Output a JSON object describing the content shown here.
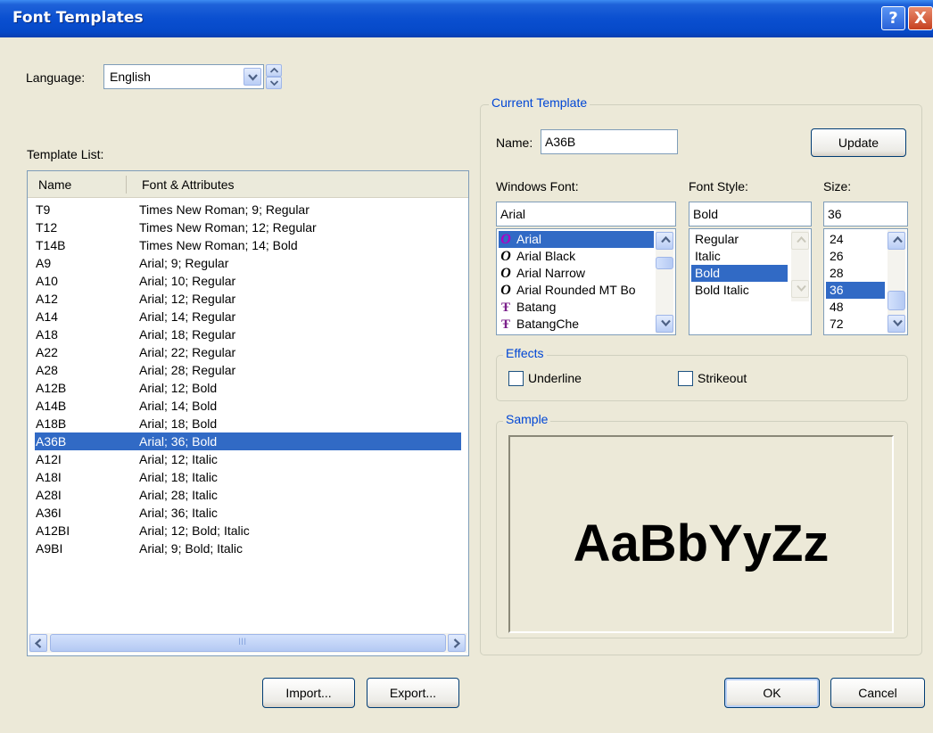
{
  "window": {
    "title": "Font Templates",
    "help_glyph": "?",
    "close_glyph": "X"
  },
  "language": {
    "label": "Language:",
    "value": "English"
  },
  "template_list": {
    "label": "Template List:",
    "columns": [
      "Name",
      "Font & Attributes"
    ],
    "rows": [
      {
        "name": "T9",
        "attrs": "Times New Roman; 9; Regular"
      },
      {
        "name": "T12",
        "attrs": "Times New Roman; 12; Regular"
      },
      {
        "name": "T14B",
        "attrs": "Times New Roman; 14; Bold"
      },
      {
        "name": "A9",
        "attrs": "Arial; 9; Regular"
      },
      {
        "name": "A10",
        "attrs": "Arial; 10; Regular"
      },
      {
        "name": "A12",
        "attrs": "Arial; 12; Regular"
      },
      {
        "name": "A14",
        "attrs": "Arial; 14; Regular"
      },
      {
        "name": "A18",
        "attrs": "Arial; 18; Regular"
      },
      {
        "name": "A22",
        "attrs": "Arial; 22; Regular"
      },
      {
        "name": "A28",
        "attrs": "Arial; 28; Regular"
      },
      {
        "name": "A12B",
        "attrs": "Arial; 12; Bold"
      },
      {
        "name": "A14B",
        "attrs": "Arial; 14; Bold"
      },
      {
        "name": "A18B",
        "attrs": "Arial; 18; Bold"
      },
      {
        "name": "A36B",
        "attrs": "Arial; 36; Bold"
      },
      {
        "name": "A12I",
        "attrs": "Arial; 12; Italic"
      },
      {
        "name": "A18I",
        "attrs": "Arial; 18; Italic"
      },
      {
        "name": "A28I",
        "attrs": "Arial; 28; Italic"
      },
      {
        "name": "A36I",
        "attrs": "Arial; 36; Italic"
      },
      {
        "name": "A12BI",
        "attrs": "Arial; 12; Bold; Italic"
      },
      {
        "name": "A9BI",
        "attrs": "Arial; 9; Bold; Italic"
      }
    ],
    "selected_name": "A36B",
    "scroll_grip": "III"
  },
  "buttons": {
    "import": "Import...",
    "export": "Export...",
    "ok": "OK",
    "cancel": "Cancel",
    "update": "Update"
  },
  "current_template": {
    "group_title": "Current Template",
    "name_label": "Name:",
    "name_value": "A36B",
    "windows_font_label": "Windows Font:",
    "windows_font_value": "Arial",
    "windows_fonts": [
      {
        "label": "Arial",
        "icon": "opentype-icon"
      },
      {
        "label": "Arial Black",
        "icon": "opentype-icon"
      },
      {
        "label": "Arial Narrow",
        "icon": "opentype-icon"
      },
      {
        "label": "Arial Rounded MT Bo",
        "icon": "opentype-icon"
      },
      {
        "label": "Batang",
        "icon": "truetype-icon"
      },
      {
        "label": "BatangChe",
        "icon": "truetype-icon"
      }
    ],
    "font_style_label": "Font Style:",
    "font_style_value": "Bold",
    "font_styles": [
      "Regular",
      "Italic",
      "Bold",
      "Bold Italic"
    ],
    "size_label": "Size:",
    "size_value": "36",
    "sizes": [
      "24",
      "26",
      "28",
      "36",
      "48",
      "72"
    ]
  },
  "effects": {
    "group_title": "Effects",
    "underline": "Underline",
    "strikeout": "Strikeout",
    "underline_checked": false,
    "strikeout_checked": false
  },
  "sample": {
    "group_title": "Sample",
    "text": "AaBbYyZz"
  },
  "colors": {
    "selection": "#316ac5",
    "group_title": "#0046d5",
    "dialog_bg": "#ece9d8"
  }
}
